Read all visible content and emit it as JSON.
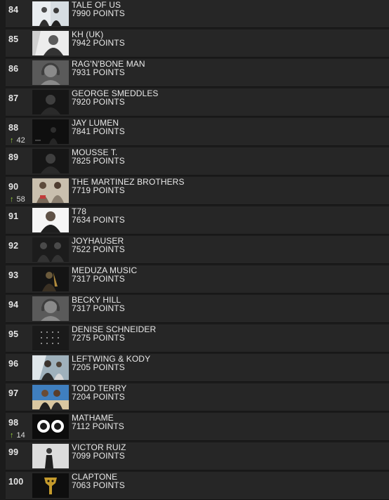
{
  "chart": {
    "rows": [
      {
        "rank": "84",
        "artist": "TALE OF US",
        "points": "7990 POINTS",
        "move": "",
        "thumb": "duo-bright"
      },
      {
        "rank": "85",
        "artist": "KH (UK)",
        "points": "7942 POINTS",
        "move": "",
        "thumb": "portrait-bright"
      },
      {
        "rank": "86",
        "artist": "RAG'N'BONE MAN",
        "points": "7931 POINTS",
        "move": "",
        "thumb": "placeholder"
      },
      {
        "rank": "87",
        "artist": "GEORGE SMEDDLES",
        "points": "7920 POINTS",
        "move": "",
        "thumb": "portrait-dark"
      },
      {
        "rank": "88",
        "artist": "JAY LUMEN",
        "points": "7841 POINTS",
        "move": "42",
        "thumb": "dark-scene"
      },
      {
        "rank": "89",
        "artist": "MOUSSE T.",
        "points": "7825 POINTS",
        "move": "",
        "thumb": "portrait-dark"
      },
      {
        "rank": "90",
        "artist": "THE MARTINEZ BROTHERS",
        "points": "7719 POINTS",
        "move": "58",
        "thumb": "duo-color"
      },
      {
        "rank": "91",
        "artist": "T78",
        "points": "7634 POINTS",
        "move": "",
        "thumb": "portrait-white"
      },
      {
        "rank": "92",
        "artist": "JOYHAUSER",
        "points": "7522 POINTS",
        "move": "",
        "thumb": "duo-dark"
      },
      {
        "rank": "93",
        "artist": "MEDUZA MUSIC",
        "points": "7317 POINTS",
        "move": "",
        "thumb": "gold-dark"
      },
      {
        "rank": "94",
        "artist": "BECKY HILL",
        "points": "7317 POINTS",
        "move": "",
        "thumb": "placeholder"
      },
      {
        "rank": "95",
        "artist": "DENISE SCHNEIDER",
        "points": "7275 POINTS",
        "move": "",
        "thumb": "text-grid"
      },
      {
        "rank": "96",
        "artist": "LEFTWING & KODY",
        "points": "7205 POINTS",
        "move": "",
        "thumb": "duo-outdoor"
      },
      {
        "rank": "97",
        "artist": "TODD TERRY",
        "points": "7204 POINTS",
        "move": "",
        "thumb": "beach"
      },
      {
        "rank": "98",
        "artist": "MATHAME",
        "points": "7112 POINTS",
        "move": "14",
        "thumb": "two-circles"
      },
      {
        "rank": "99",
        "artist": "VICTOR RUIZ",
        "points": "7099 POINTS",
        "move": "",
        "thumb": "figure-bright"
      },
      {
        "rank": "100",
        "artist": "CLAPTONE",
        "points": "7063 POINTS",
        "move": "",
        "thumb": "gold-mask"
      }
    ]
  },
  "colors": {
    "page_background": "#1b1b1b",
    "row_background": "#262626",
    "text": "#e8e8e8",
    "rise_arrow": "#9bd23d"
  },
  "icons": {
    "rise": "up-arrow-icon",
    "placeholder": "headphones-person-icon"
  }
}
